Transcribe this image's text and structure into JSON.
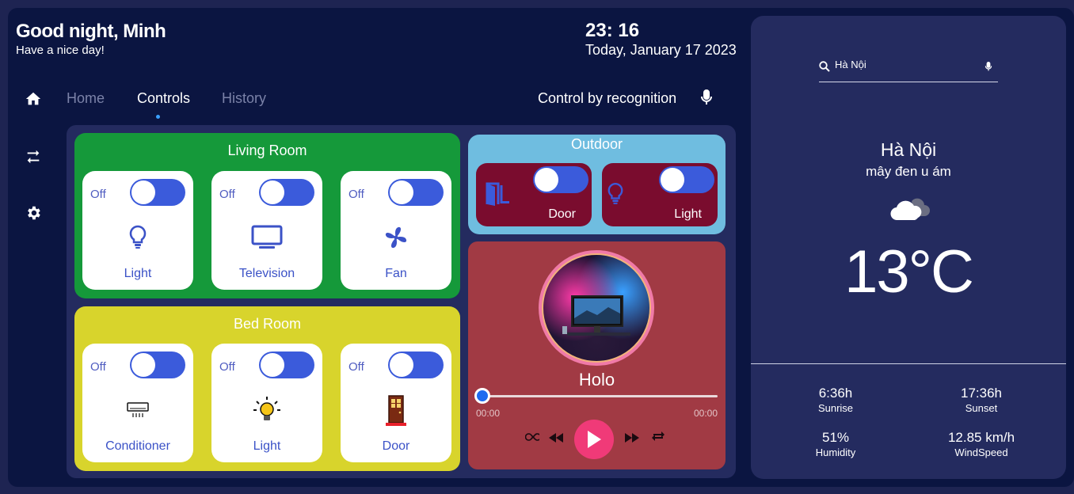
{
  "header": {
    "greeting": "Good night, Minh",
    "subtitle": "Have a nice day!",
    "time": "23: 16",
    "date": "Today, January 17 2023"
  },
  "sidebar": {
    "icons": [
      "home-icon",
      "swap-icon",
      "gear-icon"
    ]
  },
  "nav": {
    "tabs": [
      {
        "label": "Home",
        "active": false
      },
      {
        "label": "Controls",
        "active": true
      },
      {
        "label": "History",
        "active": false
      }
    ],
    "recognition_label": "Control by recognition"
  },
  "living_room": {
    "title": "Living Room",
    "color": "#15993a",
    "devices": [
      {
        "state": "Off",
        "label": "Light",
        "icon": "bulb-icon"
      },
      {
        "state": "Off",
        "label": "Television",
        "icon": "tv-icon"
      },
      {
        "state": "Off",
        "label": "Fan",
        "icon": "fan-icon"
      }
    ]
  },
  "bed_room": {
    "title": "Bed Room",
    "color": "#d8d42c",
    "devices": [
      {
        "state": "Off",
        "label": "Conditioner",
        "icon": "air-conditioner-icon"
      },
      {
        "state": "Off",
        "label": "Light",
        "icon": "lit-bulb-icon"
      },
      {
        "state": "Off",
        "label": "Door",
        "icon": "door-icon"
      }
    ]
  },
  "outdoor": {
    "title": "Outdoor",
    "color": "#6fbde0",
    "devices": [
      {
        "label": "Door",
        "icon": "door-open-icon"
      },
      {
        "label": "Light",
        "icon": "bulb-icon"
      }
    ]
  },
  "player": {
    "song": "Holo",
    "current_time": "00:00",
    "total_time": "00:00",
    "progress": 0
  },
  "weather": {
    "search_value": "Hà Nội",
    "city": "Hà Nội",
    "description": "mây đen u ám",
    "temperature": "13°C",
    "sunrise": "6:36h",
    "sunrise_label": "Sunrise",
    "sunset": "17:36h",
    "sunset_label": "Sunset",
    "humidity": "51%",
    "humidity_label": "Humidity",
    "wind": "12.85 km/h",
    "wind_label": "WindSpeed"
  }
}
